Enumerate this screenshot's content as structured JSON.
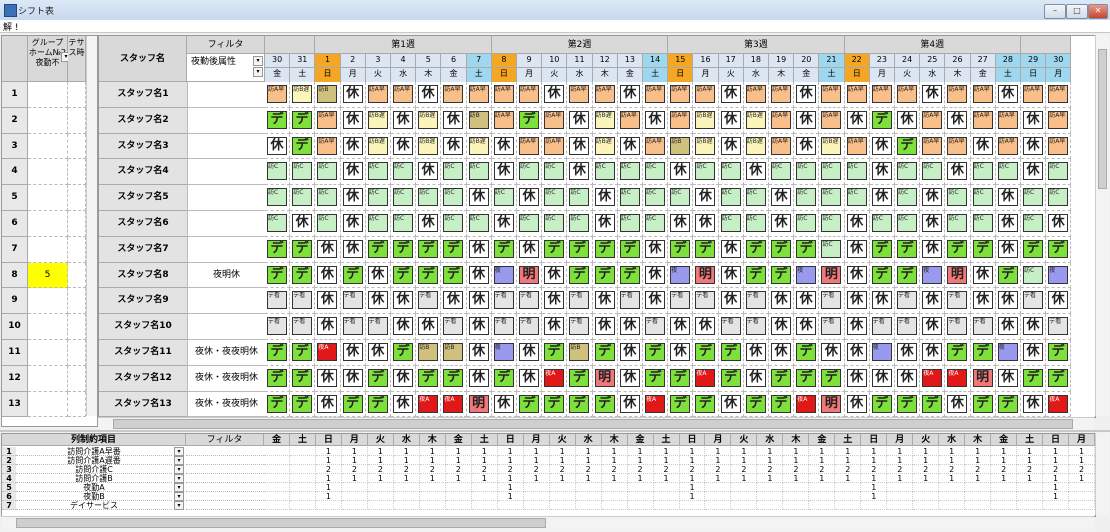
{
  "window": {
    "title": "シフト表",
    "subtitle": "解 !"
  },
  "colors": {
    "休": "#ffffff",
    "デ": "#7ee03b",
    "訪A早": "#f8bf8a",
    "訪B遅": "#fbf5bb",
    "訪C": "#c6efc6",
    "夜": "#9999ee",
    "明": "#f07878",
    "夜A": "#e01818",
    "デ看": "#e4e4e4",
    "訪B": "#cfc07e"
  },
  "left_panel": {
    "headers": [
      "グループホーム№2夜勤不",
      "テサス時"
    ],
    "rows": [
      {
        "num": "1",
        "val": ""
      },
      {
        "num": "2",
        "val": ""
      },
      {
        "num": "3",
        "val": ""
      },
      {
        "num": "4",
        "val": ""
      },
      {
        "num": "5",
        "val": ""
      },
      {
        "num": "6",
        "val": ""
      },
      {
        "num": "7",
        "val": ""
      },
      {
        "num": "8",
        "val": "5"
      },
      {
        "num": "9",
        "val": ""
      },
      {
        "num": "10",
        "val": ""
      },
      {
        "num": "11",
        "val": ""
      },
      {
        "num": "12",
        "val": ""
      },
      {
        "num": "13",
        "val": ""
      }
    ]
  },
  "main": {
    "staff_header": "スタッフ名",
    "filter_header": "フィルタ",
    "filter_select": "夜勤後属性",
    "weeks": [
      "第1週",
      "第2週",
      "第3週",
      "第4週"
    ],
    "days": [
      {
        "d": "30",
        "w": "金",
        "c": "#dbe6f2"
      },
      {
        "d": "31",
        "w": "土",
        "c": "#dbe6f2"
      },
      {
        "d": "1",
        "w": "日",
        "c": "#f5a623"
      },
      {
        "d": "2",
        "w": "月",
        "c": "#dbe6f2"
      },
      {
        "d": "3",
        "w": "火",
        "c": "#dbe6f2"
      },
      {
        "d": "4",
        "w": "水",
        "c": "#dbe6f2"
      },
      {
        "d": "5",
        "w": "木",
        "c": "#dbe6f2"
      },
      {
        "d": "6",
        "w": "金",
        "c": "#dbe6f2"
      },
      {
        "d": "7",
        "w": "土",
        "c": "#9fd8ee"
      },
      {
        "d": "8",
        "w": "日",
        "c": "#f5a623"
      },
      {
        "d": "9",
        "w": "月",
        "c": "#dbe6f2"
      },
      {
        "d": "10",
        "w": "火",
        "c": "#dbe6f2"
      },
      {
        "d": "11",
        "w": "水",
        "c": "#dbe6f2"
      },
      {
        "d": "12",
        "w": "木",
        "c": "#dbe6f2"
      },
      {
        "d": "13",
        "w": "金",
        "c": "#dbe6f2"
      },
      {
        "d": "14",
        "w": "土",
        "c": "#9fd8ee"
      },
      {
        "d": "15",
        "w": "日",
        "c": "#f5a623"
      },
      {
        "d": "16",
        "w": "月",
        "c": "#dbe6f2"
      },
      {
        "d": "17",
        "w": "火",
        "c": "#dbe6f2"
      },
      {
        "d": "18",
        "w": "水",
        "c": "#dbe6f2"
      },
      {
        "d": "19",
        "w": "木",
        "c": "#dbe6f2"
      },
      {
        "d": "20",
        "w": "金",
        "c": "#dbe6f2"
      },
      {
        "d": "21",
        "w": "土",
        "c": "#9fd8ee"
      },
      {
        "d": "22",
        "w": "日",
        "c": "#f5a623"
      },
      {
        "d": "23",
        "w": "月",
        "c": "#dbe6f2"
      },
      {
        "d": "24",
        "w": "火",
        "c": "#dbe6f2"
      },
      {
        "d": "25",
        "w": "水",
        "c": "#dbe6f2"
      },
      {
        "d": "26",
        "w": "木",
        "c": "#dbe6f2"
      },
      {
        "d": "27",
        "w": "金",
        "c": "#dbe6f2"
      },
      {
        "d": "28",
        "w": "土",
        "c": "#9fd8ee"
      },
      {
        "d": "29",
        "w": "日",
        "c": "#9fd8ee"
      },
      {
        "d": "30",
        "w": "月",
        "c": "#9fd8ee"
      }
    ],
    "staff": [
      {
        "name": "スタッフ名1",
        "filter": "",
        "shifts": [
          "訪A早",
          "訪B遅",
          "訪B",
          "休",
          "訪A早",
          "訪A早",
          "休",
          "訪A早",
          "訪A早",
          "訪A早",
          "訪A早",
          "休",
          "訪A早",
          "訪A早",
          "休",
          "訪A早",
          "訪A早",
          "訪A早",
          "休",
          "訪A早",
          "訪A早",
          "休",
          "訪A早",
          "訪A早",
          "訪A早",
          "訪A早",
          "休",
          "訪A早",
          "訪A早",
          "休",
          "訪A早",
          "訪A早"
        ]
      },
      {
        "name": "スタッフ名2",
        "filter": "",
        "shifts": [
          "デ",
          "デ",
          "訪A早",
          "休",
          "訪B遅",
          "休",
          "訪B遅",
          "休",
          "訪B",
          "訪A早",
          "デ",
          "訪A早",
          "休",
          "訪B遅",
          "訪A早",
          "休",
          "訪A早",
          "訪B遅",
          "休",
          "訪B遅",
          "訪A早",
          "休",
          "訪A早",
          "休",
          "デ",
          "休",
          "訪A早",
          "休",
          "訪A早",
          "訪A早",
          "休",
          "訪A早"
        ]
      },
      {
        "name": "スタッフ名3",
        "filter": "",
        "shifts": [
          "休",
          "デ",
          "訪A早",
          "休",
          "訪B遅",
          "休",
          "訪B遅",
          "休",
          "訪B遅",
          "休",
          "訪A早",
          "訪A早",
          "休",
          "訪B遅",
          "休",
          "訪A早",
          "訪B",
          "訪B遅",
          "休",
          "訪B遅",
          "訪A早",
          "休",
          "訪B遅",
          "訪A早",
          "休",
          "デ",
          "訪A早",
          "訪A早",
          "休",
          "訪A早",
          "休",
          "訪A早"
        ]
      },
      {
        "name": "スタッフ名4",
        "filter": "",
        "shifts": [
          "訪C",
          "訪C",
          "訪C",
          "休",
          "訪C",
          "訪C",
          "休",
          "訪C",
          "訪C",
          "休",
          "訪C",
          "訪C",
          "休",
          "訪C",
          "訪C",
          "訪C",
          "休",
          "訪C",
          "訪C",
          "休",
          "訪C",
          "訪C",
          "訪C",
          "訪C",
          "休",
          "訪C",
          "訪C",
          "休",
          "訪C",
          "訪C",
          "休",
          "訪C"
        ]
      },
      {
        "name": "スタッフ名5",
        "filter": "",
        "shifts": [
          "訪C",
          "訪C",
          "訪C",
          "休",
          "訪C",
          "訪C",
          "訪C",
          "訪C",
          "休",
          "訪C",
          "休",
          "訪C",
          "訪C",
          "休",
          "訪C",
          "訪C",
          "訪C",
          "休",
          "訪C",
          "訪C",
          "休",
          "訪C",
          "訪C",
          "訪C",
          "休",
          "訪C",
          "休",
          "訪C",
          "訪C",
          "休",
          "訪C",
          "訪C"
        ]
      },
      {
        "name": "スタッフ名6",
        "filter": "",
        "shifts": [
          "訪C",
          "休",
          "訪C",
          "休",
          "訪C",
          "訪C",
          "休",
          "訪C",
          "訪C",
          "休",
          "訪C",
          "訪C",
          "訪C",
          "休",
          "訪C",
          "訪C",
          "休",
          "休",
          "訪C",
          "訪C",
          "休",
          "訪C",
          "訪C",
          "休",
          "訪C",
          "訪C",
          "休",
          "訪C",
          "訪C",
          "休",
          "訪C",
          "休"
        ]
      },
      {
        "name": "スタッフ名7",
        "filter": "",
        "shifts": [
          "デ",
          "デ",
          "休",
          "休",
          "デ",
          "デ",
          "デ",
          "デ",
          "休",
          "デ",
          "休",
          "デ",
          "デ",
          "デ",
          "デ",
          "休",
          "デ",
          "デ",
          "休",
          "デ",
          "デ",
          "デ",
          "訪C",
          "休",
          "デ",
          "デ",
          "休",
          "デ",
          "デ",
          "休",
          "デ",
          "デ"
        ]
      },
      {
        "name": "スタッフ名8",
        "filter": "夜明休",
        "shifts": [
          "デ",
          "デ",
          "休",
          "デ",
          "休",
          "デ",
          "デ",
          "デ",
          "休",
          "夜",
          "明",
          "休",
          "デ",
          "デ",
          "デ",
          "休",
          "夜",
          "明",
          "休",
          "デ",
          "デ",
          "夜",
          "明",
          "休",
          "デ",
          "デ",
          "夜",
          "明",
          "休",
          "デ",
          "訪C",
          "夜"
        ]
      },
      {
        "name": "スタッフ名9",
        "filter": "",
        "shifts": [
          "デ看",
          "デ看",
          "休",
          "デ看",
          "休",
          "休",
          "デ看",
          "休",
          "休",
          "デ看",
          "デ看",
          "休",
          "デ看",
          "休",
          "デ看",
          "休",
          "デ看",
          "デ看",
          "休",
          "デ看",
          "休",
          "休",
          "デ看",
          "休",
          "休",
          "デ看",
          "休",
          "デ看",
          "休",
          "休",
          "デ看",
          "休"
        ]
      },
      {
        "name": "スタッフ名10",
        "filter": "",
        "shifts": [
          "デ看",
          "デ看",
          "休",
          "デ看",
          "デ看",
          "休",
          "休",
          "デ看",
          "休",
          "デ看",
          "デ看",
          "休",
          "デ看",
          "休",
          "休",
          "デ看",
          "休",
          "休",
          "デ看",
          "デ看",
          "休",
          "休",
          "デ看",
          "休",
          "デ看",
          "デ看",
          "休",
          "デ看",
          "デ看",
          "休",
          "休",
          "デ看"
        ]
      },
      {
        "name": "スタッフ名11",
        "filter": "夜休・夜夜明休",
        "shifts": [
          "デ",
          "デ",
          "夜A",
          "休",
          "休",
          "デ",
          "訪B",
          "訪B",
          "休",
          "夜",
          "休",
          "デ",
          "訪B",
          "デ",
          "休",
          "デ",
          "休",
          "デ",
          "デ",
          "休",
          "休",
          "デ",
          "休",
          "休",
          "夜",
          "休",
          "休",
          "デ",
          "デ",
          "夜",
          "休",
          "デ"
        ]
      },
      {
        "name": "スタッフ名12",
        "filter": "夜休・夜夜明休",
        "shifts": [
          "デ",
          "デ",
          "休",
          "休",
          "デ",
          "休",
          "デ",
          "デ",
          "休",
          "デ",
          "休",
          "夜A",
          "デ",
          "明",
          "休",
          "デ",
          "デ",
          "夜A",
          "デ",
          "休",
          "デ",
          "デ",
          "デ",
          "休",
          "休",
          "休",
          "夜A",
          "夜A",
          "明",
          "休",
          "デ",
          "デ"
        ]
      },
      {
        "name": "スタッフ名13",
        "filter": "夜休・夜夜明休",
        "shifts": [
          "デ",
          "デ",
          "休",
          "デ",
          "デ",
          "休",
          "夜A",
          "夜A",
          "明",
          "休",
          "デ",
          "デ",
          "デ",
          "デ",
          "休",
          "夜A",
          "デ",
          "デ",
          "休",
          "デ",
          "デ",
          "夜A",
          "明",
          "休",
          "デ",
          "デ",
          "デ",
          "休",
          "デ",
          "デ",
          "休",
          "夜A"
        ]
      }
    ]
  },
  "bottom": {
    "item_header": "列制約項目",
    "filter_header": "フィルタ",
    "days": [
      "金",
      "土",
      "日",
      "月",
      "火",
      "水",
      "木",
      "金",
      "土",
      "日",
      "月",
      "火",
      "水",
      "木",
      "金",
      "土",
      "日",
      "月",
      "火",
      "水",
      "木",
      "金",
      "土",
      "日",
      "月",
      "火",
      "水",
      "木",
      "金",
      "土",
      "日",
      "月"
    ],
    "rows": [
      {
        "num": "1",
        "name": "訪問介護A早番",
        "vals": [
          "",
          "",
          "1",
          "1",
          "1",
          "1",
          "1",
          "1",
          "1",
          "1",
          "1",
          "1",
          "1",
          "1",
          "1",
          "1",
          "1",
          "1",
          "1",
          "1",
          "1",
          "1",
          "1",
          "1",
          "1",
          "1",
          "1",
          "1",
          "1",
          "1",
          "1",
          "1"
        ]
      },
      {
        "num": "2",
        "name": "訪問介護A遅番",
        "vals": [
          "",
          "",
          "1",
          "1",
          "1",
          "1",
          "1",
          "1",
          "1",
          "1",
          "1",
          "1",
          "1",
          "1",
          "1",
          "1",
          "1",
          "1",
          "1",
          "1",
          "1",
          "1",
          "1",
          "1",
          "1",
          "1",
          "1",
          "1",
          "1",
          "1",
          "1",
          "1"
        ]
      },
      {
        "num": "3",
        "name": "訪問介護C",
        "vals": [
          "",
          "",
          "2",
          "2",
          "2",
          "2",
          "2",
          "2",
          "2",
          "2",
          "2",
          "2",
          "2",
          "2",
          "2",
          "2",
          "2",
          "2",
          "2",
          "2",
          "2",
          "2",
          "2",
          "2",
          "2",
          "2",
          "2",
          "2",
          "2",
          "2",
          "2",
          "2"
        ]
      },
      {
        "num": "4",
        "name": "訪問介護B",
        "vals": [
          "",
          "",
          "1",
          "1",
          "1",
          "1",
          "1",
          "1",
          "1",
          "1",
          "1",
          "1",
          "1",
          "1",
          "1",
          "1",
          "1",
          "1",
          "1",
          "1",
          "1",
          "1",
          "1",
          "1",
          "1",
          "1",
          "1",
          "1",
          "1",
          "1",
          "1",
          "1"
        ]
      },
      {
        "num": "5",
        "name": "夜勤A",
        "vals": [
          "",
          "",
          "1",
          "",
          "",
          "",
          "",
          "",
          "",
          "1",
          "",
          "",
          "",
          "",
          "",
          "",
          "1",
          "",
          "",
          "",
          "",
          "",
          "",
          "1",
          "",
          "",
          "",
          "",
          "",
          "",
          "1",
          ""
        ]
      },
      {
        "num": "6",
        "name": "夜勤B",
        "vals": [
          "",
          "",
          "1",
          "",
          "",
          "",
          "",
          "",
          "",
          "1",
          "",
          "",
          "",
          "",
          "",
          "",
          "1",
          "",
          "",
          "",
          "",
          "",
          "",
          "1",
          "",
          "",
          "",
          "",
          "",
          "",
          "1",
          ""
        ]
      },
      {
        "num": "7",
        "name": "デイサービス",
        "vals": [
          "",
          "",
          "",
          "",
          "",
          "",
          "",
          "",
          "",
          "",
          "",
          "",
          "",
          "",
          "",
          "",
          "",
          "",
          "",
          "",
          "",
          "",
          "",
          "",
          "",
          "",
          "",
          "",
          "",
          "",
          "",
          ""
        ]
      }
    ]
  }
}
